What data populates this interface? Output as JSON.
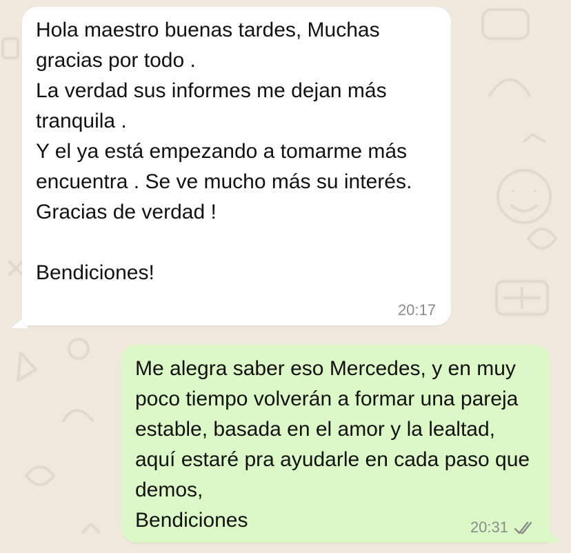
{
  "chat": {
    "incoming_message": {
      "text": "Hola maestro buenas tardes, Muchas gracias por todo .\nLa verdad sus informes me dejan más tranquila .\nY el ya está empezando a tomarme más encuentra . Se ve mucho más su interés.\nGracias de verdad !\n\nBendiciones!",
      "time": "20:17"
    },
    "outgoing_message": {
      "text": "Me alegra saber eso Mercedes, y en muy poco tiempo volverán a formar una pareja estable, basada en el amor y la lealtad, aquí estaré pra ayudarle en cada paso que demos,\nBendiciones",
      "time": "20:31",
      "status_icon": "double-check-icon"
    }
  },
  "colors": {
    "background": "#efe8dd",
    "incoming_bubble": "#ffffff",
    "outgoing_bubble": "#dcf8c6",
    "text": "#111111",
    "timestamp": "#8b8b8b"
  }
}
